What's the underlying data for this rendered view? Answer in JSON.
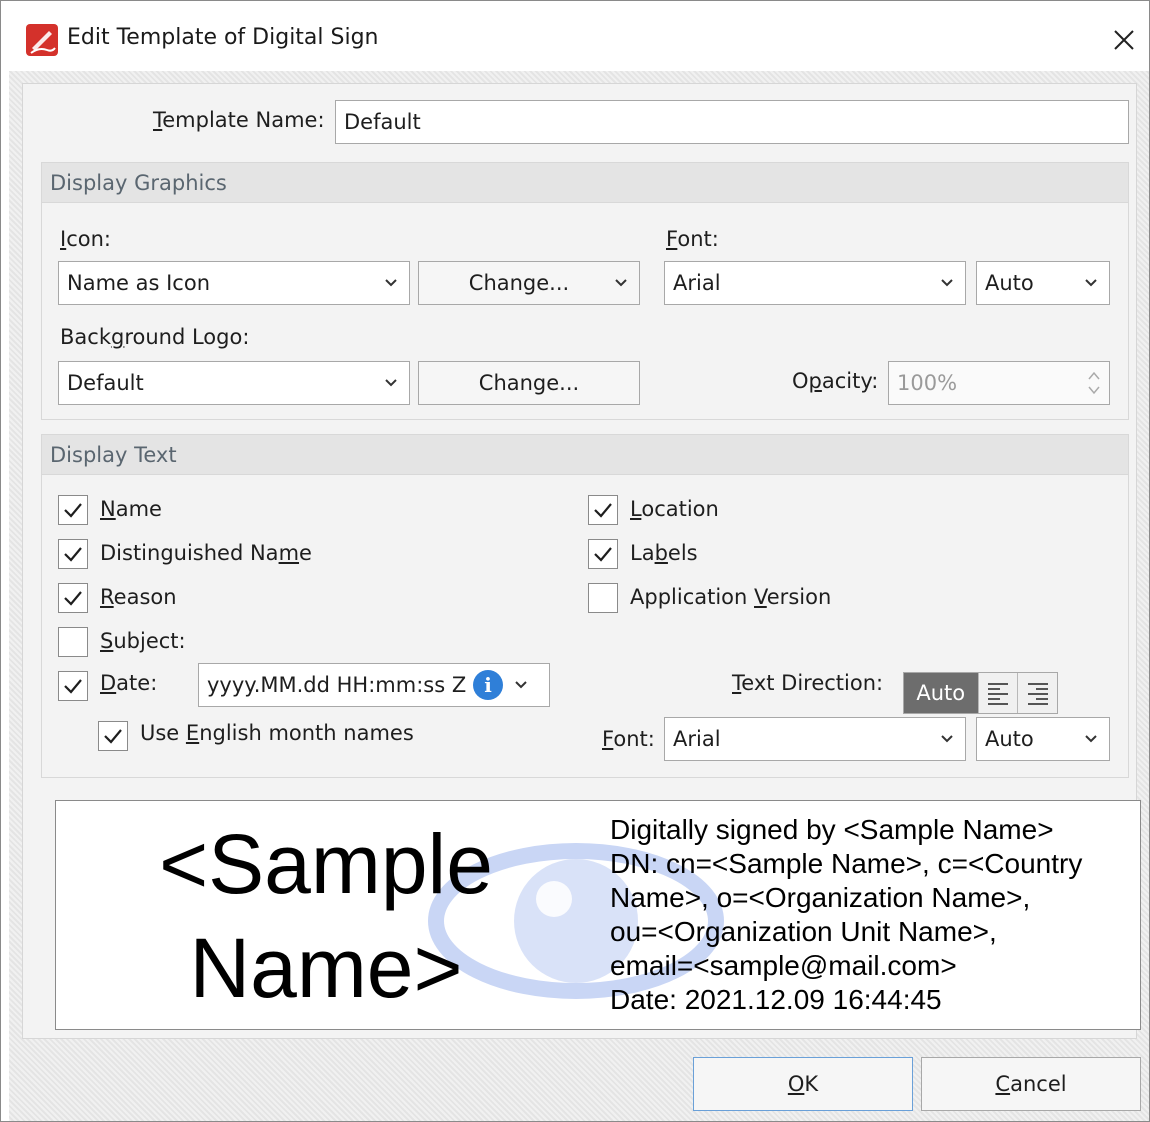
{
  "window": {
    "title": "Edit Template of Digital Sign"
  },
  "template": {
    "label_pre": "",
    "label_ul": "T",
    "label_post": "emplate Name:",
    "value": "Default"
  },
  "display_graphics": {
    "header": "Display Graphics",
    "icon": {
      "label_ul": "I",
      "label_post": "con:",
      "value": "Name as Icon",
      "change_label": "Change..."
    },
    "font": {
      "label_ul": "F",
      "label_post": "ont:",
      "value": "Arial",
      "size": "Auto"
    },
    "background_logo": {
      "label_pre": "Back",
      "label_ul": "g",
      "label_post": "round Logo:",
      "value": "Default",
      "change_label": "Change..."
    },
    "opacity": {
      "label_pre": "O",
      "label_ul": "p",
      "label_post": "acity:",
      "value": "100%"
    }
  },
  "display_text": {
    "header": "Display Text",
    "checkboxes": {
      "name": {
        "pre": "",
        "ul": "N",
        "post": "ame",
        "checked": true
      },
      "distinguished_name": {
        "pre": "Distinguished Na",
        "ul": "m",
        "post": "e",
        "checked": true
      },
      "reason": {
        "pre": "",
        "ul": "R",
        "post": "eason",
        "checked": true
      },
      "subject": {
        "pre": "",
        "ul": "S",
        "post": "ubject:",
        "checked": false
      },
      "date": {
        "pre": "",
        "ul": "D",
        "post": "ate:",
        "checked": true
      },
      "english_months": {
        "pre": "Use ",
        "ul": "E",
        "post": "nglish month names",
        "checked": true
      },
      "location": {
        "pre": "",
        "ul": "L",
        "post": "ocation",
        "checked": true
      },
      "labels": {
        "pre": "La",
        "ul": "b",
        "post": "els",
        "checked": true
      },
      "app_version": {
        "pre": "Application ",
        "ul": "V",
        "post": "ersion",
        "checked": false
      }
    },
    "date_format": "yyyy.MM.dd HH:mm:ss Z",
    "text_direction": {
      "ul": "T",
      "post": "ext Direction:",
      "auto_label": "Auto",
      "selected": "Auto"
    },
    "font": {
      "ul": "F",
      "post": "ont:",
      "value": "Arial",
      "size": "Auto"
    }
  },
  "preview": {
    "name_line1": "<Sample",
    "name_line2": "Name>",
    "lines": [
      "Digitally signed by <Sample Name>",
      "DN: cn=<Sample Name>, c=<Country",
      "Name>, o=<Organization Name>,",
      "ou=<Organization Unit Name>,",
      "email=<sample@mail.com>",
      "Date: 2021.12.09 16:44:45"
    ]
  },
  "buttons": {
    "ok": {
      "ul": "O",
      "post": "K"
    },
    "cancel": {
      "ul": "C",
      "post": "ancel"
    }
  },
  "colors": {
    "accent": "#2f7fd8",
    "app_icon_red": "#d4312b",
    "watermark_blue": "#c9d6f5"
  }
}
